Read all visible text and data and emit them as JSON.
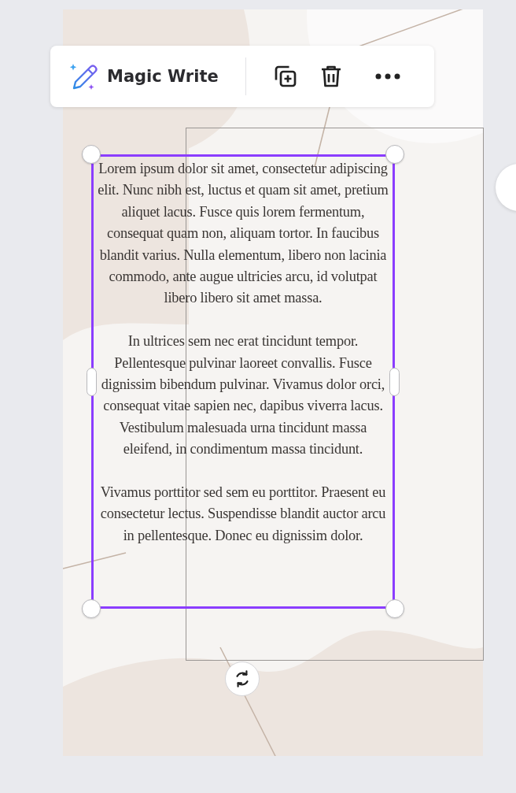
{
  "toolbar": {
    "magic_write": "Magic Write"
  },
  "text_box": {
    "selected": true,
    "paragraphs": [
      "Lorem ipsum dolor sit amet, consectetur adipiscing elit. Nunc nibh est, luctus et quam sit amet, pretium aliquet lacus. Fusce quis lorem fermentum, consequat quam non, aliquam tortor. In faucibus blandit varius. Nulla elementum, libero non lacinia commodo, ante augue ultricies arcu, id volutpat libero libero sit amet massa.",
      "In ultrices sem nec erat tincidunt tempor. Pellentesque pulvinar laoreet convallis. Fusce dignissim bibendum pulvinar. Vivamus dolor orci, consequat vitae sapien nec, dapibus viverra lacus. Vestibulum malesuada urna tincidunt massa eleifend, in condimentum massa tincidunt.",
      "Vivamus porttitor sed sem eu porttitor. Praesent eu consectetur lectus. Suspendisse blandit auctor arcu in pellentesque. Donec eu dignissim dolor."
    ]
  }
}
